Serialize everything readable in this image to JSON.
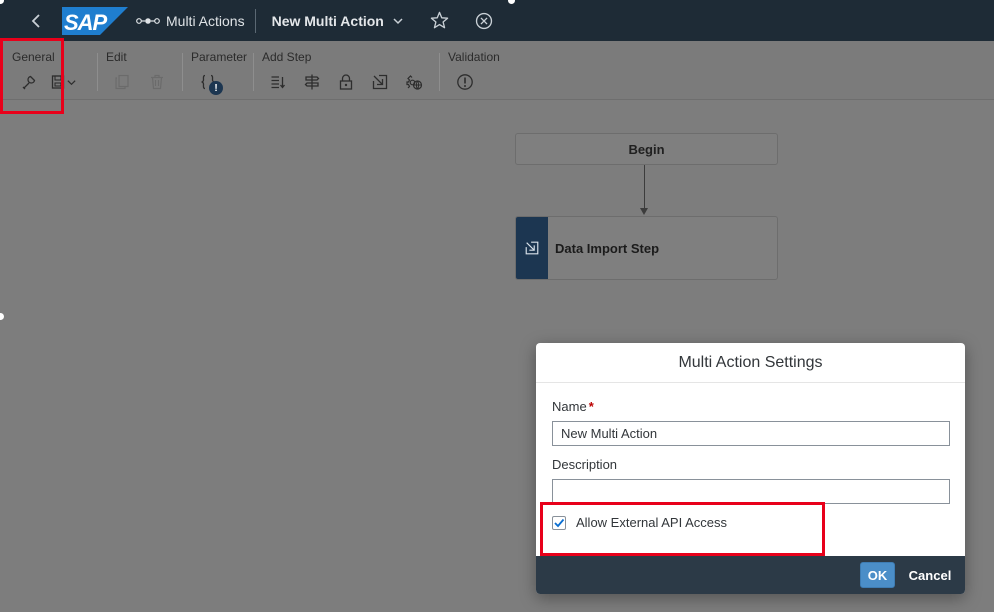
{
  "shell": {
    "logo": "SAP",
    "app_name": "Multi Actions",
    "document_title": "New Multi Action"
  },
  "toolbar": {
    "groups": {
      "general": "General",
      "edit": "Edit",
      "parameter": "Parameter",
      "add_step": "Add Step",
      "validation": "Validation"
    },
    "parameter_badge": "!"
  },
  "canvas": {
    "begin_label": "Begin",
    "step_label": "Data Import Step"
  },
  "dialog": {
    "title": "Multi Action Settings",
    "name_label": "Name",
    "required_marker": "*",
    "name_value": "New Multi Action",
    "description_label": "Description",
    "description_value": "",
    "api_access_label": "Allow External API Access",
    "api_access_checked": true,
    "ok_label": "OK",
    "cancel_label": "Cancel"
  },
  "colors": {
    "shell_bg": "#1e2b36",
    "accent": "#1c3651",
    "primary_button": "#4b8ec8",
    "footer_bg": "#2c3a47",
    "highlight": "#e8001a",
    "required": "#bb0000"
  }
}
